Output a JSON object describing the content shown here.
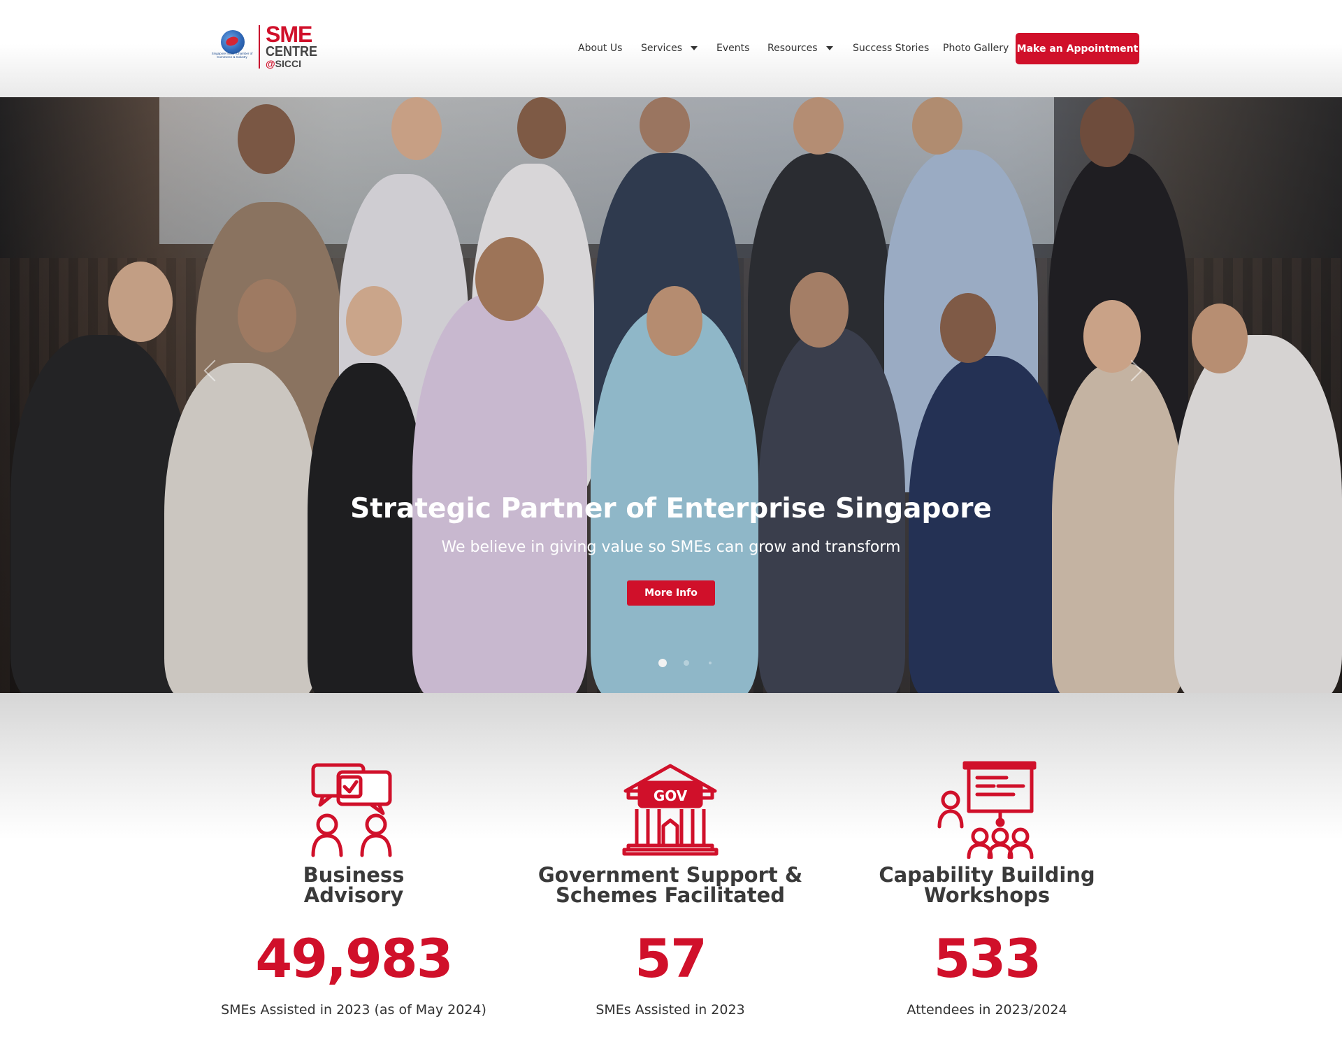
{
  "brand": {
    "logo_org_caption": "Singapore Indian Chamber of Commerce & Industry",
    "logo_line1": "SME",
    "logo_line2": "CENTRE",
    "logo_line3_at": "@",
    "logo_line3": "SICCI"
  },
  "nav": {
    "items": [
      {
        "label": "About Us",
        "has_dropdown": false
      },
      {
        "label": "Services",
        "has_dropdown": true
      },
      {
        "label": "Events",
        "has_dropdown": false
      },
      {
        "label": "Resources",
        "has_dropdown": true
      },
      {
        "label": "Success Stories",
        "has_dropdown": false
      },
      {
        "label": "Photo Gallery",
        "has_dropdown": false
      }
    ],
    "cta_label": "Make an Appointment"
  },
  "hero": {
    "title": "Strategic Partner of Enterprise Singapore",
    "subtitle": "We believe in giving value so SMEs can grow and transform",
    "button_label": "More Info",
    "slide_count": 3,
    "active_slide": 1
  },
  "stats": [
    {
      "icon": "advisory-chat-people-icon",
      "title": "Business\nAdvisory",
      "value": "49,983",
      "caption": "SMEs Assisted in 2023 (as of May 2024)"
    },
    {
      "icon": "gov-building-icon",
      "title": "Government Support &\nSchemes Facilitated",
      "value": "57",
      "caption": "SMEs Assisted in 2023"
    },
    {
      "icon": "workshop-presentation-icon",
      "title": "Capability Building\nWorkshops",
      "value": "533",
      "caption": "Attendees in 2023/2024"
    }
  ],
  "colors": {
    "brand_red": "#d0102a",
    "text_dark": "#333333"
  }
}
